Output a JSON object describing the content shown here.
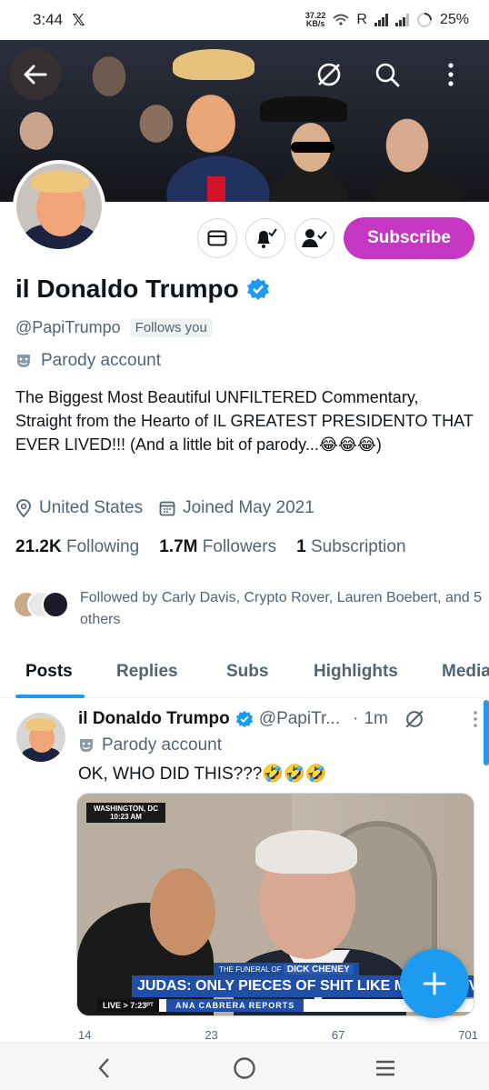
{
  "status_bar": {
    "time": "3:44",
    "x_label": "𝕏",
    "speed_value": "37.22",
    "speed_unit": "KB/s",
    "roaming": "R",
    "battery": "25%"
  },
  "profile": {
    "name": "il Donaldo Trumpo",
    "handle": "@PapiTrumpo",
    "follows_you": "Follows you",
    "parody_label": "Parody account",
    "bio": "The Biggest Most Beautiful UNFILTERED Commentary, Straight from the Hearto of IL GREATEST PRESIDENTO THAT EVER LIVED!!! (And a little bit of parody...😂😂😂)",
    "location": "United States",
    "joined": "Joined May 2021",
    "following_count": "21.2K",
    "following_label": "Following",
    "followers_count": "1.7M",
    "followers_label": "Followers",
    "subscription_count": "1",
    "subscription_label": "Subscription",
    "followed_by": "Followed by Carly Davis, Crypto Rover, Lauren Boebert, and 5 others",
    "subscribe_label": "Subscribe"
  },
  "tabs": [
    "Posts",
    "Replies",
    "Subs",
    "Highlights",
    "Media"
  ],
  "active_tab": "Posts",
  "post": {
    "name": "il Donaldo Trumpo",
    "handle": "@PapiTr...",
    "dot": "·",
    "time": "1m",
    "parody_label": "Parody account",
    "text": "OK, WHO DID THIS???🤣🤣🤣",
    "media": {
      "location_line1": "WASHINGTON, DC",
      "location_line2": "10:23 AM",
      "chyron_prefix": "THE FUNERAL OF",
      "chyron_topic": "DICK CHENEY",
      "chyron_main": "JUDAS: ONLY PIECES OF SHIT LIKE ME ARE INVITED",
      "live": "LIVE > 7:23ᴾᵀ",
      "reporter": "ANA CABRERA REPORTS"
    },
    "actions": [
      "14",
      "23",
      "67",
      "701"
    ]
  },
  "colors": {
    "accent": "#1d9bf0",
    "subscribe": "#c536c2",
    "text_primary": "#0f1419",
    "text_secondary": "#536471"
  },
  "icons": {
    "back": "arrow-left-icon",
    "grok": "grok-icon",
    "search": "search-icon",
    "more": "more-vertical-icon",
    "message": "envelope-icon",
    "notify": "bell-check-icon",
    "following": "person-check-icon",
    "verified": "verified-badge-icon",
    "parody": "theater-mask-icon",
    "location": "location-pin-icon",
    "calendar": "calendar-icon",
    "compose": "plus-icon",
    "nav_back": "chevron-left-icon",
    "nav_home": "circle-home-icon",
    "nav_recents": "menu-lines-icon"
  }
}
